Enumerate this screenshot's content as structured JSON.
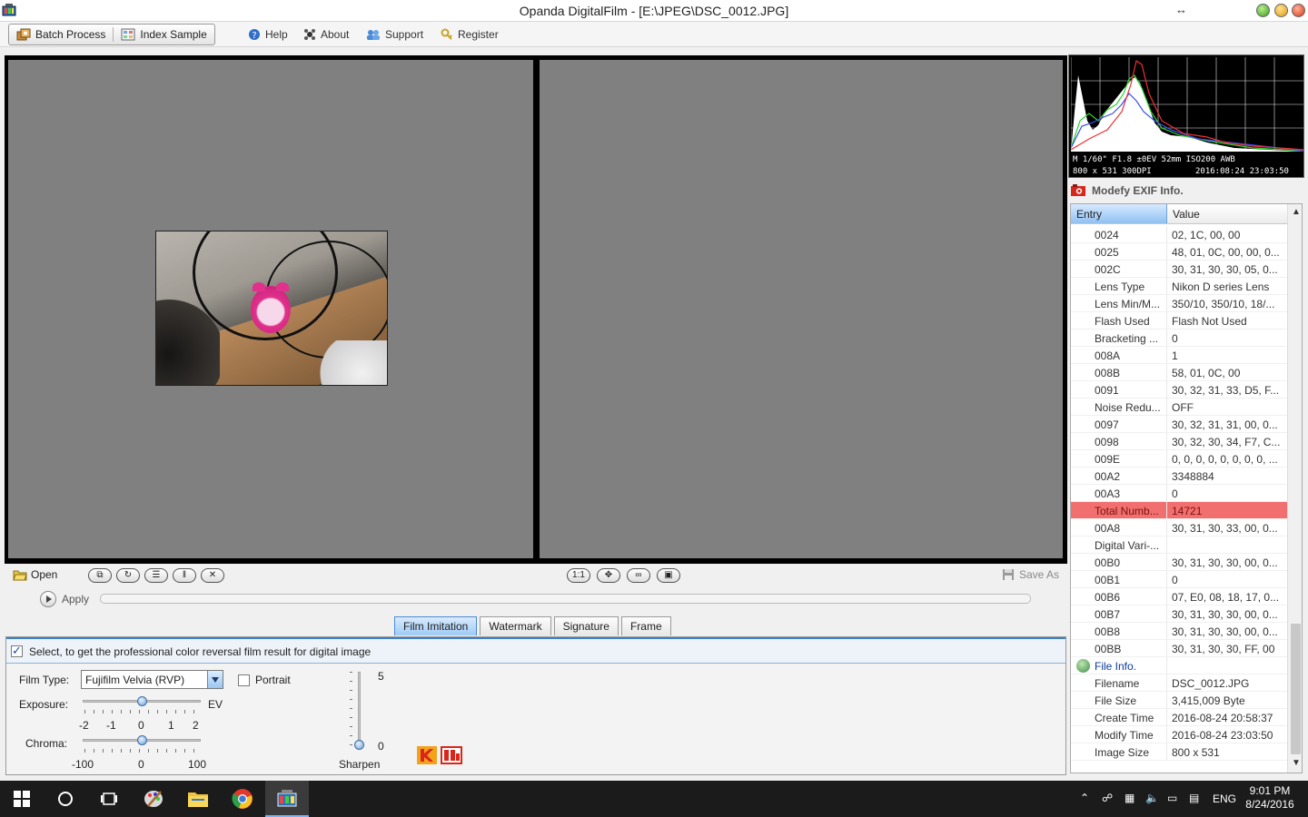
{
  "window": {
    "title": "Opanda DigitalFilm - [E:\\JPEG\\DSC_0012.JPG]"
  },
  "toolbar": {
    "batch_label": "Batch Process",
    "index_label": "Index Sample",
    "help_label": "Help",
    "about_label": "About",
    "support_label": "Support",
    "register_label": "Register"
  },
  "controls": {
    "open_label": "Open",
    "zoom_label": "1:1",
    "save_as_label": "Save As",
    "apply_label": "Apply"
  },
  "tabs": [
    {
      "label": "Film Imitation",
      "active": true
    },
    {
      "label": "Watermark",
      "active": false
    },
    {
      "label": "Signature",
      "active": false
    },
    {
      "label": "Frame",
      "active": false
    }
  ],
  "film": {
    "select_text": "Select, to get the professional color reversal film result for digital image",
    "select_checked": true,
    "film_type_label": "Film Type:",
    "film_type_value": "Fujifilm Velvia (RVP)",
    "portrait_label": "Portrait",
    "portrait_checked": false,
    "exposure_label": "Exposure:",
    "exposure_unit": "EV",
    "exposure_ticks": [
      "-2",
      "-1",
      "0",
      "1",
      "2"
    ],
    "exposure_value": 0,
    "chroma_label": "Chroma:",
    "chroma_ticks": [
      "-100",
      "0",
      "100"
    ],
    "chroma_value": 0,
    "sharpen_label": "Sharpen",
    "sharpen_max": "5",
    "sharpen_min": "0",
    "sharpen_value": 0
  },
  "histogram": {
    "line1": "M 1/60\" F1.8 ±0EV 52mm ISO200 AWB",
    "line2_left": "800 x 531  300DPI",
    "line2_right": "2016:08:24 23:03:50"
  },
  "exif": {
    "heading": "Modefy EXIF Info.",
    "col_entry": "Entry",
    "col_value": "Value",
    "rows": [
      {
        "entry": "0024",
        "value": "02, 1C, 00, 00"
      },
      {
        "entry": "0025",
        "value": "48, 01, 0C, 00, 00, 0..."
      },
      {
        "entry": "002C",
        "value": "30, 31, 30, 30, 05, 0..."
      },
      {
        "entry": "Lens Type",
        "value": "Nikon D series Lens"
      },
      {
        "entry": "Lens Min/M...",
        "value": "350/10, 350/10, 18/..."
      },
      {
        "entry": "Flash Used",
        "value": "Flash Not Used"
      },
      {
        "entry": "Bracketing ...",
        "value": "0"
      },
      {
        "entry": "008A",
        "value": "1"
      },
      {
        "entry": "008B",
        "value": "58, 01, 0C, 00"
      },
      {
        "entry": "0091",
        "value": "30, 32, 31, 33, D5, F..."
      },
      {
        "entry": "Noise Redu...",
        "value": "OFF"
      },
      {
        "entry": "0097",
        "value": "30, 32, 31, 31, 00, 0..."
      },
      {
        "entry": "0098",
        "value": "30, 32, 30, 34, F7, C..."
      },
      {
        "entry": "009E",
        "value": "0, 0, 0, 0, 0, 0, 0, 0, ..."
      },
      {
        "entry": "00A2",
        "value": "3348884"
      },
      {
        "entry": "00A3",
        "value": "0"
      },
      {
        "entry": "Total Numb...",
        "value": "14721",
        "highlight": true
      },
      {
        "entry": "00A8",
        "value": "30, 31, 30, 33, 00, 0..."
      },
      {
        "entry": "Digital Vari-...",
        "value": ""
      },
      {
        "entry": "00B0",
        "value": "30, 31, 30, 30, 00, 0..."
      },
      {
        "entry": "00B1",
        "value": "0"
      },
      {
        "entry": "00B6",
        "value": "07, E0, 08, 18, 17, 0..."
      },
      {
        "entry": "00B7",
        "value": "30, 31, 30, 30, 00, 0..."
      },
      {
        "entry": "00B8",
        "value": "30, 31, 30, 30, 00, 0..."
      },
      {
        "entry": "00BB",
        "value": "30, 31, 30, 30, FF, 00"
      }
    ],
    "file_section": "File Info.",
    "file_rows": [
      {
        "entry": "Filename",
        "value": "DSC_0012.JPG"
      },
      {
        "entry": "File Size",
        "value": "3,415,009 Byte"
      },
      {
        "entry": "Create Time",
        "value": "2016-08-24 20:58:37"
      },
      {
        "entry": "Modify Time",
        "value": "2016-08-24 23:03:50"
      },
      {
        "entry": "Image Size",
        "value": "800 x 531"
      }
    ]
  },
  "taskbar": {
    "lang": "ENG",
    "time": "9:01 PM",
    "date": "8/24/2016"
  },
  "colors": {
    "highlight_row": "#f26f6f",
    "tab_active": "#9fcbf4",
    "panel_gray": "#808080"
  }
}
